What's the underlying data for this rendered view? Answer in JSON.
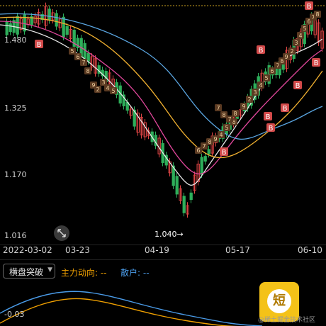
{
  "price_axis": {
    "labels": [
      "1.480",
      "1.325",
      "1.170",
      "1.016"
    ]
  },
  "date_axis": {
    "labels": [
      "2022-03-02",
      "03-23",
      "04-19",
      "05-17",
      "06-10"
    ]
  },
  "annotations": {
    "low_price": "1.040→"
  },
  "signal_badges": {
    "buy": "B",
    "sell": "S",
    "counter_labels": [
      "5",
      "6",
      "7",
      "8",
      "9",
      "2",
      "3",
      "4",
      "5",
      "6",
      "7",
      "8",
      "9",
      "4",
      "5",
      "6",
      "7",
      "8",
      "7",
      "8",
      "9",
      "2",
      "3",
      "4",
      "5",
      "6",
      "7",
      "8",
      "9",
      "2",
      "3",
      "4",
      "5",
      "6",
      "7",
      "8"
    ]
  },
  "indicator_bar": {
    "selector_label": "横盘突破",
    "main_flow_label": "主力动向: --",
    "retail_label": "散户: --",
    "colors": {
      "main_flow": "#f0a000",
      "retail": "#4a9be8"
    }
  },
  "sub_chart": {
    "axis_label": "-0.03"
  },
  "app_card": {
    "glyph": "短"
  },
  "watermark": "@稀土掘金技术社区",
  "colors": {
    "up": "#e04545",
    "down": "#2eae5a",
    "ma_white": "#e8e8e8",
    "ma_magenta": "#e0479b",
    "ma_yellow": "#f0b030",
    "ma_blue": "#5aa5e0",
    "ref_line": "#c8a020"
  },
  "icons": {
    "zoom": "zoom-arrows-icon"
  }
}
